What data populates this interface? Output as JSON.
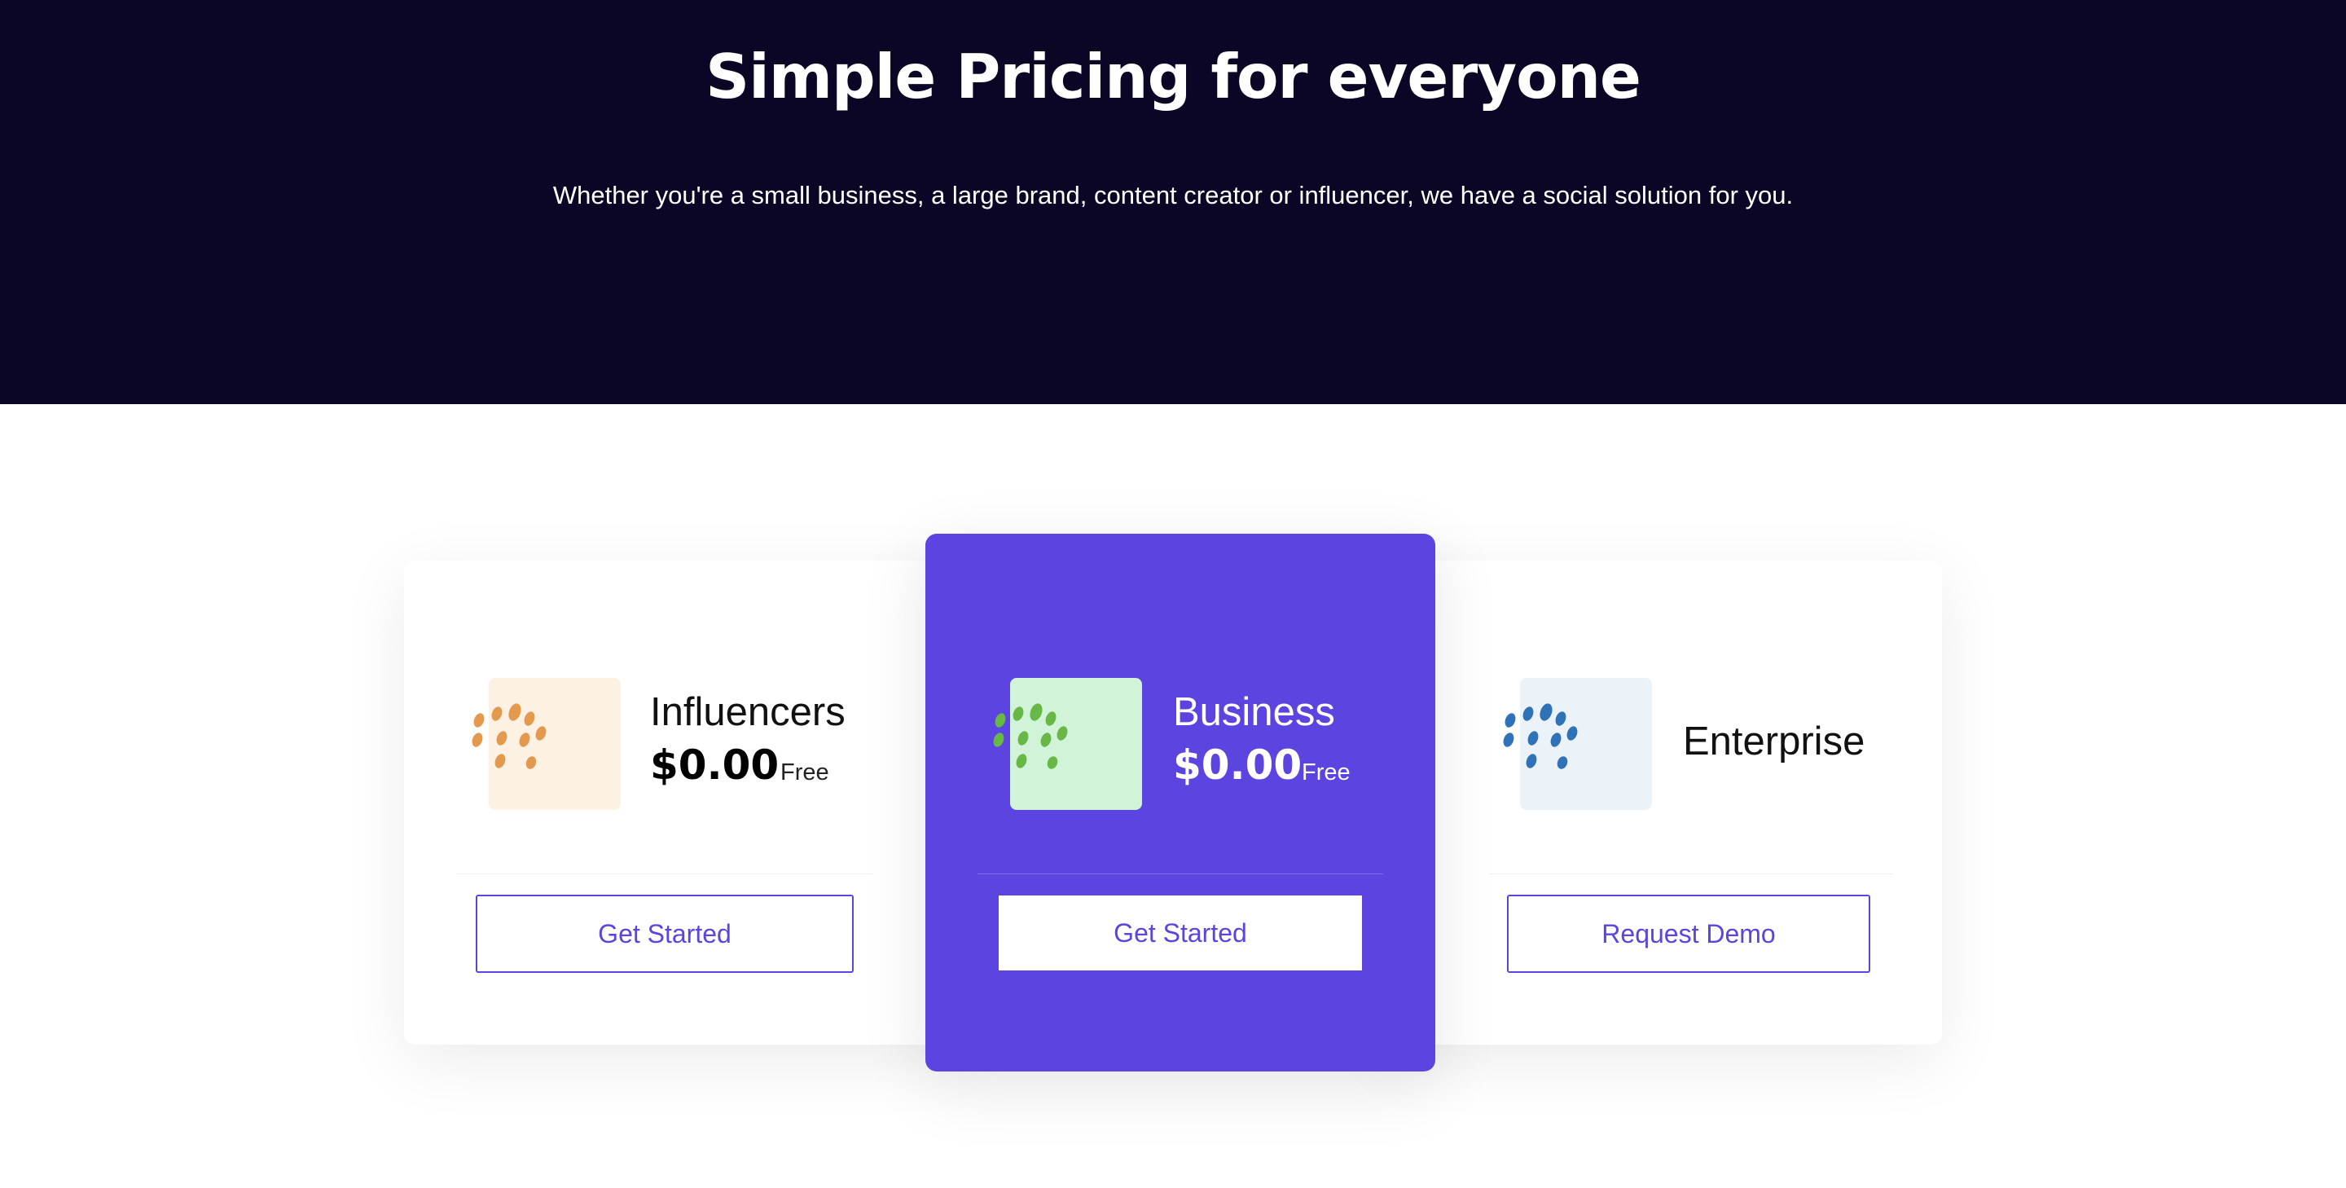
{
  "hero": {
    "title": "Simple Pricing for everyone",
    "subtitle": "Whether you're a small business, a large brand, content creator or influencer, we have a social solution for you."
  },
  "colors": {
    "hero_bg": "#0b0625",
    "accent": "#5b44e0",
    "influencers_tint": "#fdf1e4",
    "influencers_dots": "#e49a4e",
    "business_tint": "#d1f4d9",
    "business_dots": "#67b846",
    "enterprise_tint": "#ecf3f8",
    "enterprise_dots": "#2f72b8"
  },
  "plans": [
    {
      "name": "Influencers",
      "price": "$0.00",
      "note": "Free",
      "button": "Get Started",
      "icon": "dots-icon"
    },
    {
      "name": "Business",
      "price": "$0.00",
      "note": "Free",
      "button": "Get Started",
      "icon": "dots-icon",
      "featured": true
    },
    {
      "name": "Enterprise",
      "button": "Request Demo",
      "icon": "dots-icon"
    }
  ]
}
